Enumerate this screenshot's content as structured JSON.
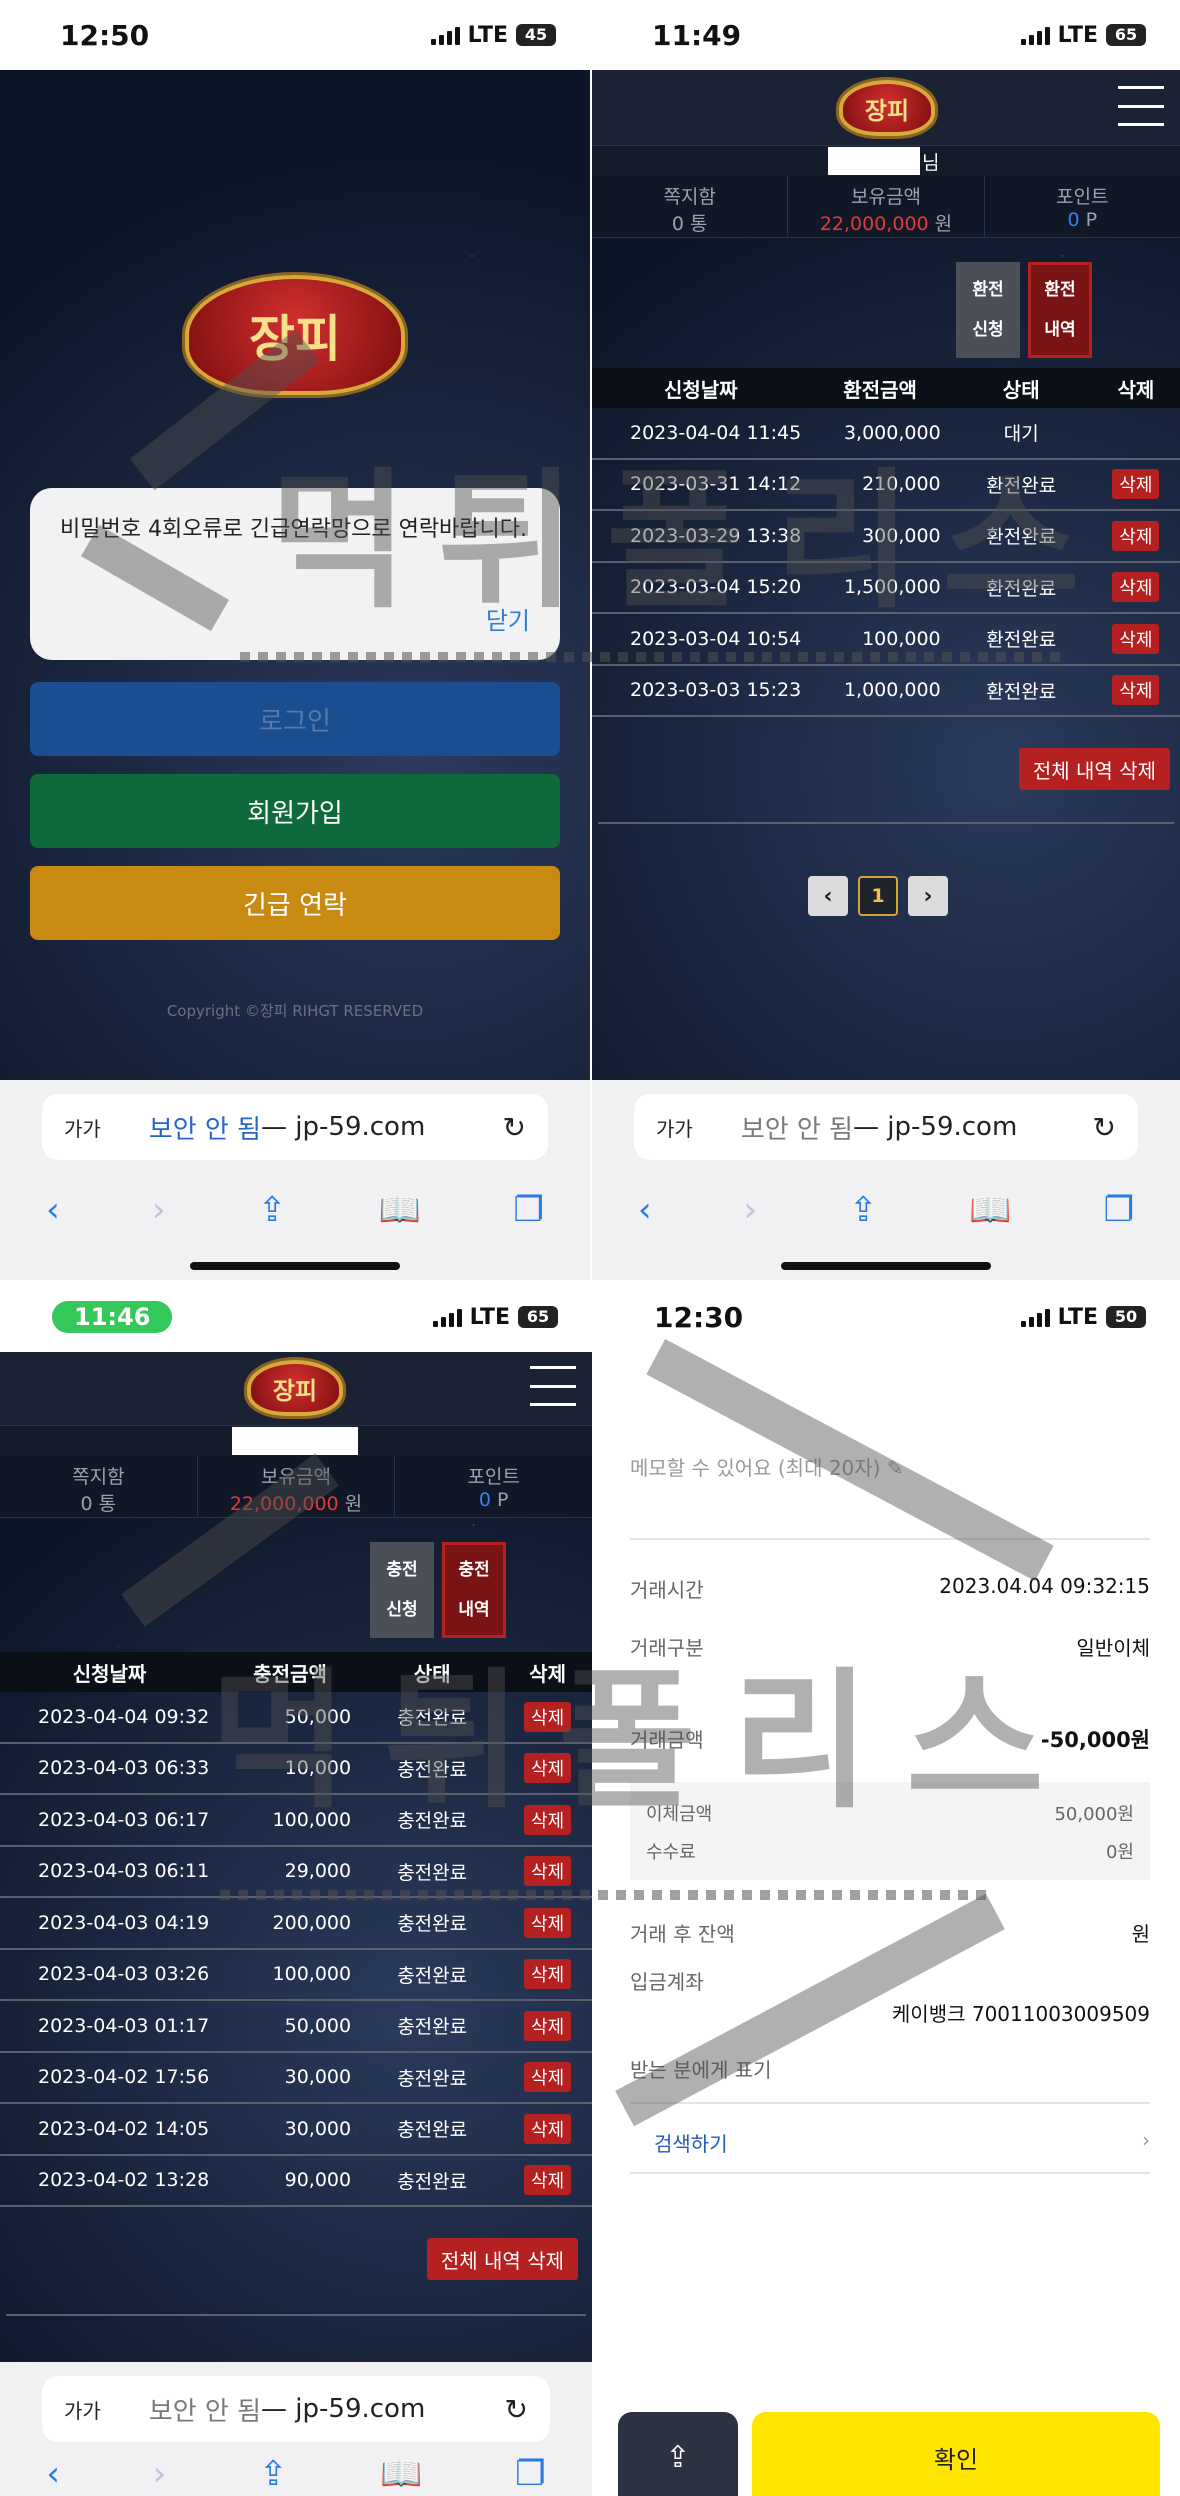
{
  "q1": {
    "status": {
      "time": "12:50",
      "network": "LTE",
      "battery": "45"
    },
    "logo_text": "장피",
    "alert": {
      "message": "비밀번호 4회오류로 긴급연락망으로 연락바랍니다.",
      "close": "닫기"
    },
    "buttons": {
      "login": "로그인",
      "signup": "회원가입",
      "emergency": "긴급 연락"
    },
    "copyright": "Copyright ©장피 RIHGT RESERVED",
    "browser": {
      "aa": "가가",
      "insecure": "보안 안 됨",
      "domain": " — jp-59.com"
    },
    "colors": {
      "login": "#1a4e91",
      "signup": "#0e6a3a",
      "emergency": "#c98a12"
    }
  },
  "q2": {
    "status": {
      "time": "11:49",
      "network": "LTE",
      "battery": "65"
    },
    "logo_text": "장피",
    "name_suffix": "님",
    "info": {
      "messages_label": "쪽지함",
      "messages_value": "0 통",
      "balance_label": "보유금액",
      "balance_value": "22,000,000",
      "balance_unit": " 원",
      "points_label": "포인트",
      "points_value": "0",
      "points_unit": " P"
    },
    "tabs": {
      "apply_top": "환전",
      "apply_bottom": "신청",
      "history_top": "환전",
      "history_bottom": "내역"
    },
    "table": {
      "headers": [
        "신청날짜",
        "환전금액",
        "상태",
        "삭제"
      ],
      "rows": [
        {
          "date": "2023-04-04 11:45",
          "amount": "3,000,000",
          "status": "대기",
          "del": ""
        },
        {
          "date": "2023-03-31 14:12",
          "amount": "210,000",
          "status": "환전완료",
          "del": "삭제"
        },
        {
          "date": "2023-03-29 13:38",
          "amount": "300,000",
          "status": "환전완료",
          "del": "삭제"
        },
        {
          "date": "2023-03-04 15:20",
          "amount": "1,500,000",
          "status": "환전완료",
          "del": "삭제"
        },
        {
          "date": "2023-03-04 10:54",
          "amount": "100,000",
          "status": "환전완료",
          "del": "삭제"
        },
        {
          "date": "2023-03-03 15:23",
          "amount": "1,000,000",
          "status": "환전완료",
          "del": "삭제"
        }
      ]
    },
    "delete_all": "전체 내역 삭제",
    "pager": {
      "prev": "‹",
      "current": "1",
      "next": "›"
    },
    "browser": {
      "aa": "가가",
      "insecure": "보안 안 됨",
      "domain": " — jp-59.com"
    }
  },
  "q3": {
    "status": {
      "time": "11:46",
      "network": "LTE",
      "battery": "65"
    },
    "logo_text": "장피",
    "info": {
      "messages_label": "쪽지함",
      "messages_value": "0 통",
      "balance_label": "보유금액",
      "balance_value": "22,000,000",
      "balance_unit": " 원",
      "points_label": "포인트",
      "points_value": "0",
      "points_unit": " P"
    },
    "tabs": {
      "apply_top": "충전",
      "apply_bottom": "신청",
      "history_top": "충전",
      "history_bottom": "내역"
    },
    "table": {
      "headers": [
        "신청날짜",
        "충전금액",
        "상태",
        "삭제"
      ],
      "rows": [
        {
          "date": "2023-04-04 09:32",
          "amount": "50,000",
          "status": "충전완료",
          "del": "삭제"
        },
        {
          "date": "2023-04-03 06:33",
          "amount": "10,000",
          "status": "충전완료",
          "del": "삭제"
        },
        {
          "date": "2023-04-03 06:17",
          "amount": "100,000",
          "status": "충전완료",
          "del": "삭제"
        },
        {
          "date": "2023-04-03 06:11",
          "amount": "29,000",
          "status": "충전완료",
          "del": "삭제"
        },
        {
          "date": "2023-04-03 04:19",
          "amount": "200,000",
          "status": "충전완료",
          "del": "삭제"
        },
        {
          "date": "2023-04-03 03:26",
          "amount": "100,000",
          "status": "충전완료",
          "del": "삭제"
        },
        {
          "date": "2023-04-03 01:17",
          "amount": "50,000",
          "status": "충전완료",
          "del": "삭제"
        },
        {
          "date": "2023-04-02 17:56",
          "amount": "30,000",
          "status": "충전완료",
          "del": "삭제"
        },
        {
          "date": "2023-04-02 14:05",
          "amount": "30,000",
          "status": "충전완료",
          "del": "삭제"
        },
        {
          "date": "2023-04-02 13:28",
          "amount": "90,000",
          "status": "충전완료",
          "del": "삭제"
        }
      ]
    },
    "delete_all": "전체 내역 삭제",
    "browser": {
      "aa": "가가",
      "insecure": "보안 안 됨",
      "domain": " — jp-59.com"
    }
  },
  "q4": {
    "status": {
      "time": "12:30",
      "network": "LTE",
      "battery": "50"
    },
    "memo": "메모할 수 있어요 (최대 20자)",
    "time_label": "거래시간",
    "time_value": "2023.04.04 09:32:15",
    "type_label": "거래구분",
    "type_value": "일반이체",
    "amount_label": "거래금액",
    "amount_value": "-50,000원",
    "transfer_label": "이체금액",
    "transfer_value": "50,000원",
    "fee_label": "수수료",
    "fee_value": "0원",
    "balance_label": "거래 후 잔액",
    "balance_value": "원",
    "account_label": "입금계좌",
    "account_value": "케이뱅크 70011003009509",
    "recipient_label": "받는 분에게 표기",
    "recipient_value": "",
    "search": "검색하기",
    "confirm": "확인"
  },
  "watermark": "먹튀폴리스"
}
